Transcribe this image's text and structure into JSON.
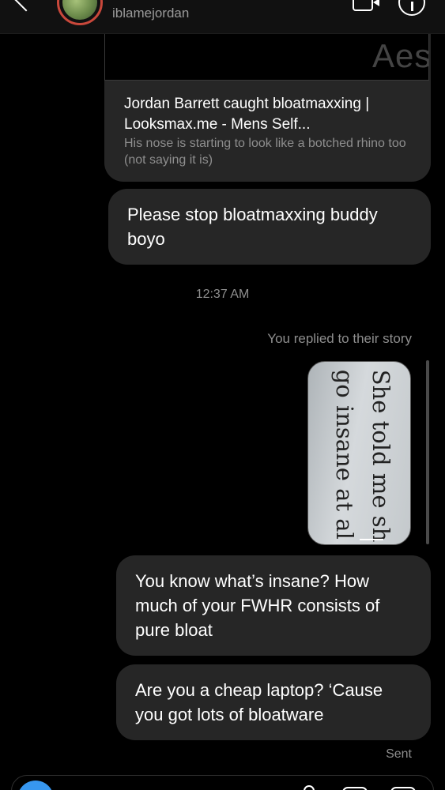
{
  "header": {
    "username": "iblamejordan"
  },
  "link_card": {
    "preview_text": "Aes",
    "title": "Jordan Barrett caught bloatmaxxing | Looksmax.me - Mens Self...",
    "description": "His nose is starting to look like a botched rhino too (not saying it is)"
  },
  "messages": [
    {
      "text": "Please stop bloatmaxxing buddy boyo"
    },
    {
      "text": "You know what’s insane? How much of your FWHR consists of pure bloat"
    },
    {
      "text": "Are you a cheap laptop? ‘Cause you got lots of bloatware"
    }
  ],
  "timestamp": "12:37 AM",
  "story_reply": {
    "label": "You replied to their story",
    "image_lines": [
      "She told me sh",
      "go insane at al"
    ]
  },
  "status": "Sent",
  "colors": {
    "background": "#000000",
    "bubble": "#262626",
    "muted_text": "#8e8e8e",
    "accent": "#3797f0",
    "story_ring": "#c9483b"
  },
  "icons": [
    "back-icon",
    "video-call-icon",
    "info-icon",
    "camera-icon",
    "mic-icon",
    "gallery-icon",
    "sticker-icon"
  ]
}
